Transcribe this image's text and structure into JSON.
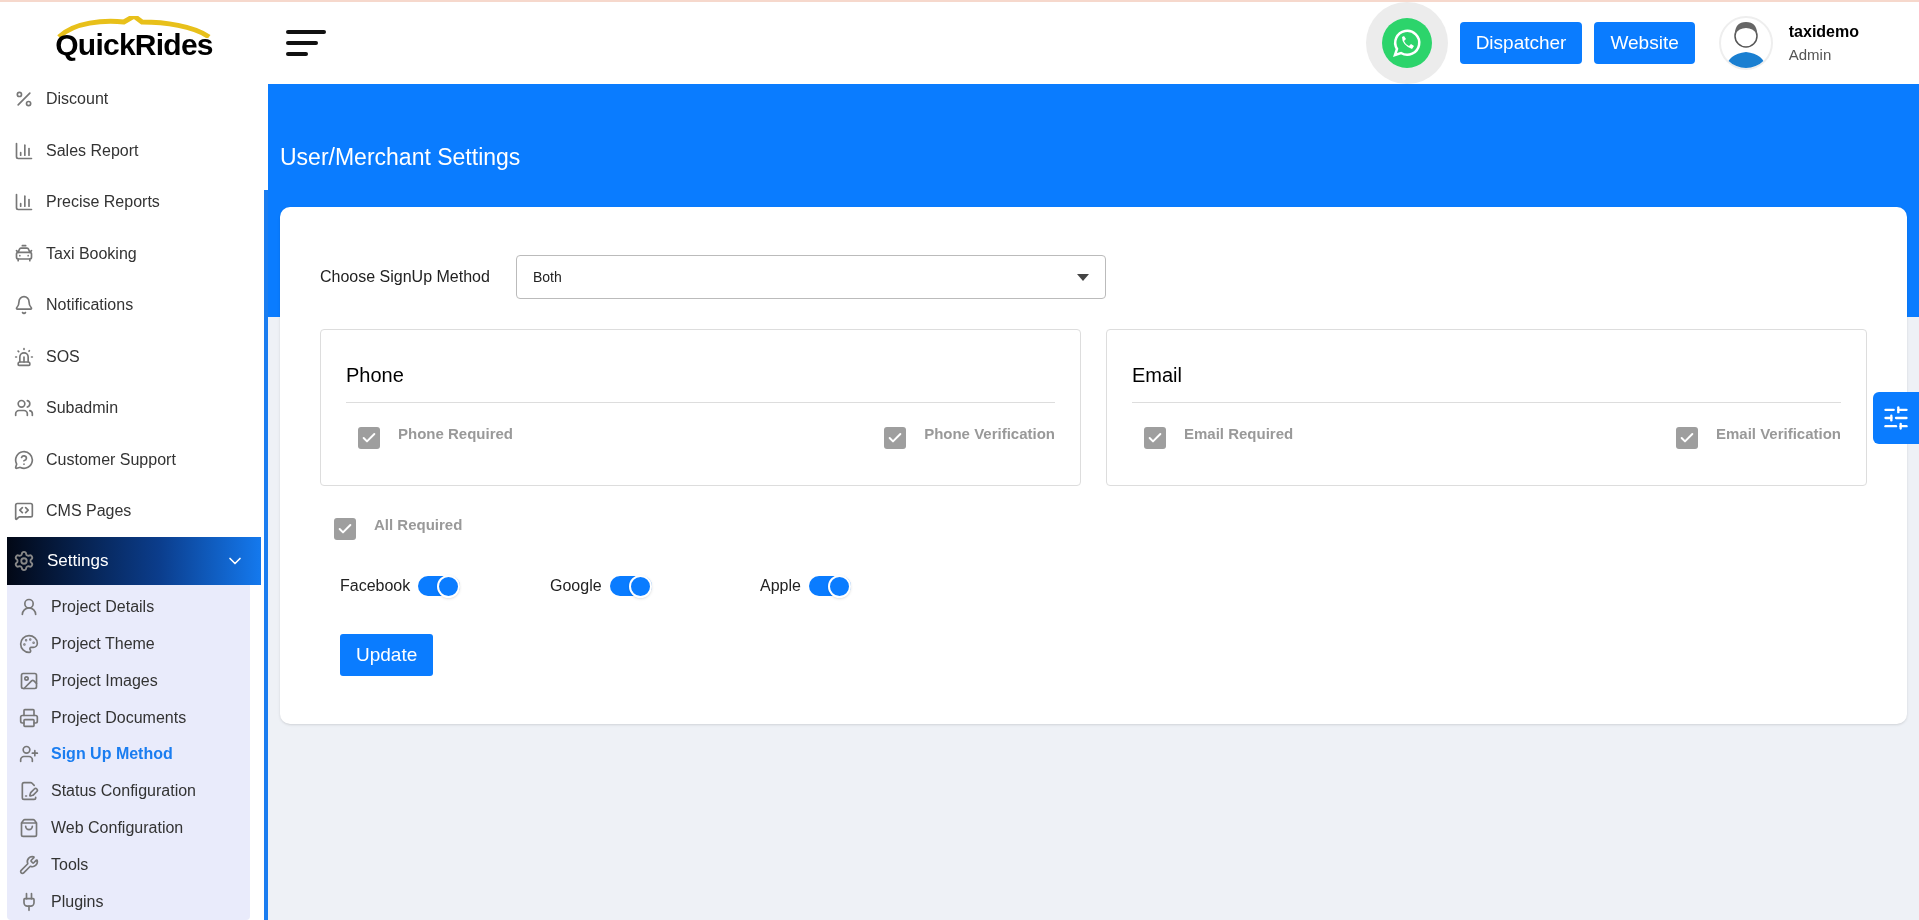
{
  "logo": {
    "text": "QuickRides"
  },
  "sidebar": {
    "items": [
      {
        "label": "Discount"
      },
      {
        "label": "Sales Report"
      },
      {
        "label": "Precise Reports"
      },
      {
        "label": "Taxi Booking"
      },
      {
        "label": "Notifications"
      },
      {
        "label": "SOS"
      },
      {
        "label": "Subadmin"
      },
      {
        "label": "Customer Support"
      },
      {
        "label": "CMS Pages"
      }
    ],
    "group": {
      "label": "Settings",
      "expanded": true,
      "children": [
        {
          "label": "Project Details",
          "selected": false
        },
        {
          "label": "Project Theme",
          "selected": false
        },
        {
          "label": "Project Images",
          "selected": false
        },
        {
          "label": "Project Documents",
          "selected": false
        },
        {
          "label": "Sign Up Method",
          "selected": true
        },
        {
          "label": "Status Configuration",
          "selected": false
        },
        {
          "label": "Web Configuration",
          "selected": false
        },
        {
          "label": "Tools",
          "selected": false
        },
        {
          "label": "Plugins",
          "selected": false
        }
      ]
    }
  },
  "header": {
    "buttons": [
      "Dispatcher",
      "Website"
    ],
    "user": {
      "name": "taxidemo",
      "role": "Admin"
    }
  },
  "page": {
    "title": "User/Merchant Settings",
    "signup_method": {
      "label": "Choose SignUp Method",
      "value": "Both"
    },
    "sections": [
      {
        "title": "Phone",
        "options": [
          {
            "label": "Phone Required",
            "checked": true
          },
          {
            "label": "Phone Verification",
            "checked": true
          }
        ]
      },
      {
        "title": "Email",
        "options": [
          {
            "label": "Email Required",
            "checked": true
          },
          {
            "label": "Email Verification",
            "checked": true
          }
        ]
      }
    ],
    "all_required": {
      "label": "All Required",
      "checked": true
    },
    "social": [
      {
        "label": "Facebook",
        "on": true
      },
      {
        "label": "Google",
        "on": true
      },
      {
        "label": "Apple",
        "on": true
      }
    ],
    "submit": "Update"
  }
}
